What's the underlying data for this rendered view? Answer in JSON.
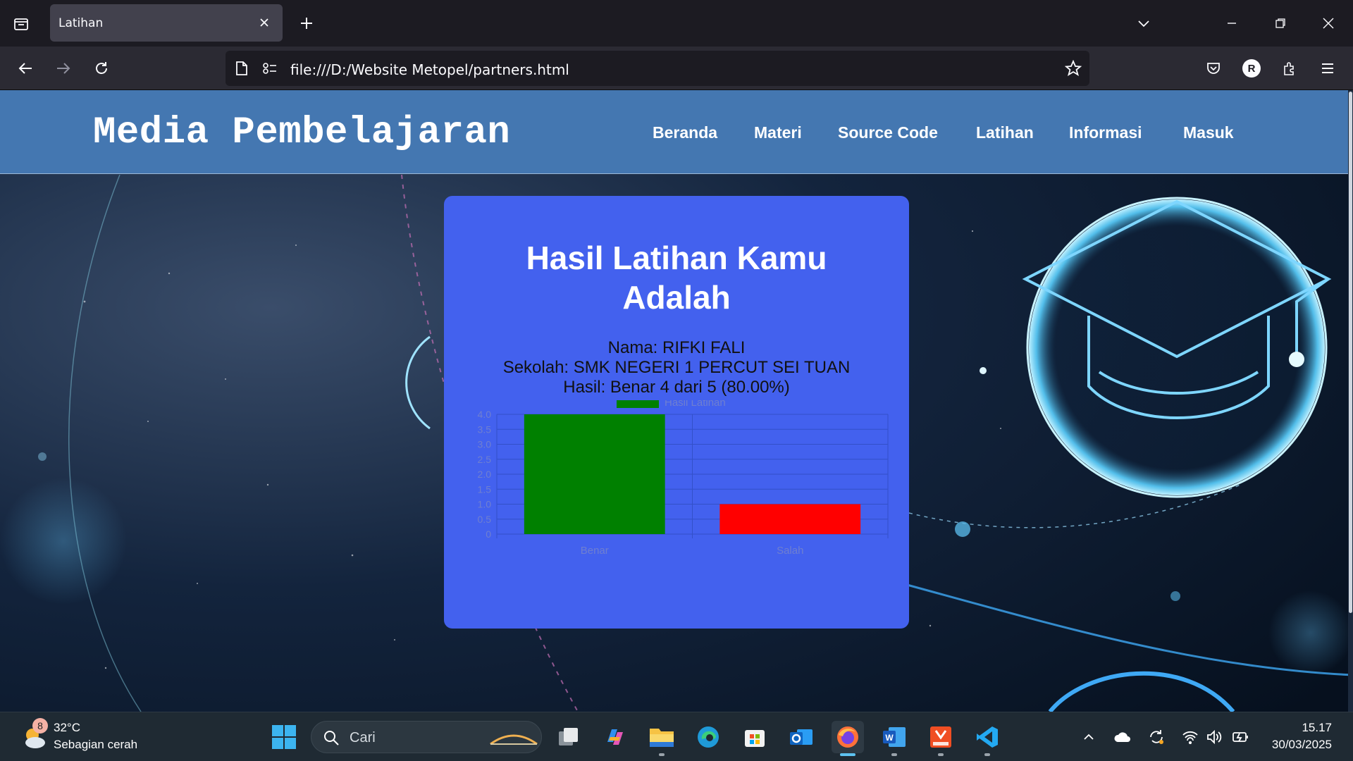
{
  "browser": {
    "tab_title": "Latihan",
    "url": "file:///D:/Website Metopel/partners.html"
  },
  "site": {
    "brand": "Media Pembelajaran",
    "menu": [
      "Beranda",
      "Materi",
      "Source Code",
      "Latihan",
      "Informasi",
      "Masuk"
    ]
  },
  "result": {
    "title_line1": "Hasil Latihan Kamu",
    "title_line2": "Adalah",
    "name": "Nama: RIFKI FALI",
    "school": "Sekolah: SMK NEGERI 1 PERCUT SEI TUAN",
    "score": "Hasil: Benar 4 dari 5 (80.00%)"
  },
  "chart_data": {
    "type": "bar",
    "categories": [
      "Benar",
      "Salah"
    ],
    "series": [
      {
        "name": "Hasil Latihan",
        "values": [
          4,
          1
        ]
      }
    ],
    "bar_colors": [
      "#008000",
      "#ff0000"
    ],
    "legend_color": "#008000",
    "ylim": [
      0,
      4
    ],
    "y_ticks": [
      "0",
      "0.5",
      "1.0",
      "1.5",
      "2.0",
      "2.5",
      "3.0",
      "3.5",
      "4.0"
    ],
    "y_tick_values": [
      0,
      0.5,
      1,
      1.5,
      2,
      2.5,
      3,
      3.5,
      4
    ],
    "grid": true,
    "legend_position": "top-center"
  },
  "taskbar": {
    "weather_badge": "8",
    "temperature": "32°C",
    "condition": "Sebagian cerah",
    "search_placeholder": "Cari",
    "time": "15.17",
    "date": "30/03/2025"
  },
  "colors": {
    "header": "#4477b1",
    "card": "#4361ee",
    "taskbar": "#1f2a33"
  }
}
